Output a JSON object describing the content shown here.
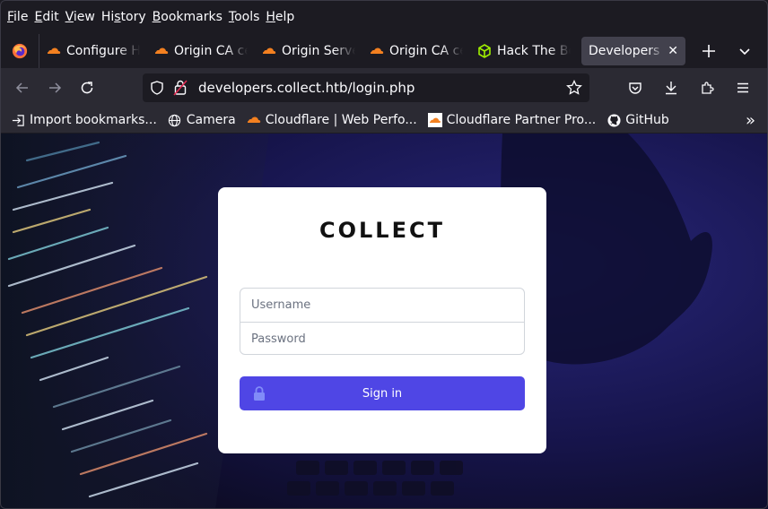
{
  "menu": [
    "File",
    "Edit",
    "View",
    "History",
    "Bookmarks",
    "Tools",
    "Help"
  ],
  "menu_access_keys": [
    "F",
    "E",
    "V",
    "s",
    "B",
    "T",
    "H"
  ],
  "tabs": [
    {
      "label": "Configure H",
      "icon": "cloudflare-icon"
    },
    {
      "label": "Origin CA ce",
      "icon": "cloudflare-icon"
    },
    {
      "label": "Origin Serve",
      "icon": "cloudflare-icon"
    },
    {
      "label": "Origin CA ce",
      "icon": "cloudflare-icon"
    },
    {
      "label": "Hack The Bo",
      "icon": "hackthebox-icon"
    },
    {
      "label": "Developers C",
      "icon": null,
      "active": true
    }
  ],
  "url": "developers.collect.htb/login.php",
  "bookmarks": [
    {
      "label": "Import bookmarks...",
      "icon": "import-icon"
    },
    {
      "label": "Camera",
      "icon": "globe-icon"
    },
    {
      "label": "Cloudflare | Web Perfo...",
      "icon": "cloudflare-icon"
    },
    {
      "label": "Cloudflare Partner Pro...",
      "icon": "cloudflare-icon"
    },
    {
      "label": "GitHub",
      "icon": "github-icon"
    }
  ],
  "colors": {
    "accent": "#4f46e5",
    "cloudflare": "#f38020",
    "htb": "#9fef00"
  },
  "login": {
    "title": "COLLECT",
    "username_placeholder": "Username",
    "password_placeholder": "Password",
    "signin_label": "Sign in"
  }
}
